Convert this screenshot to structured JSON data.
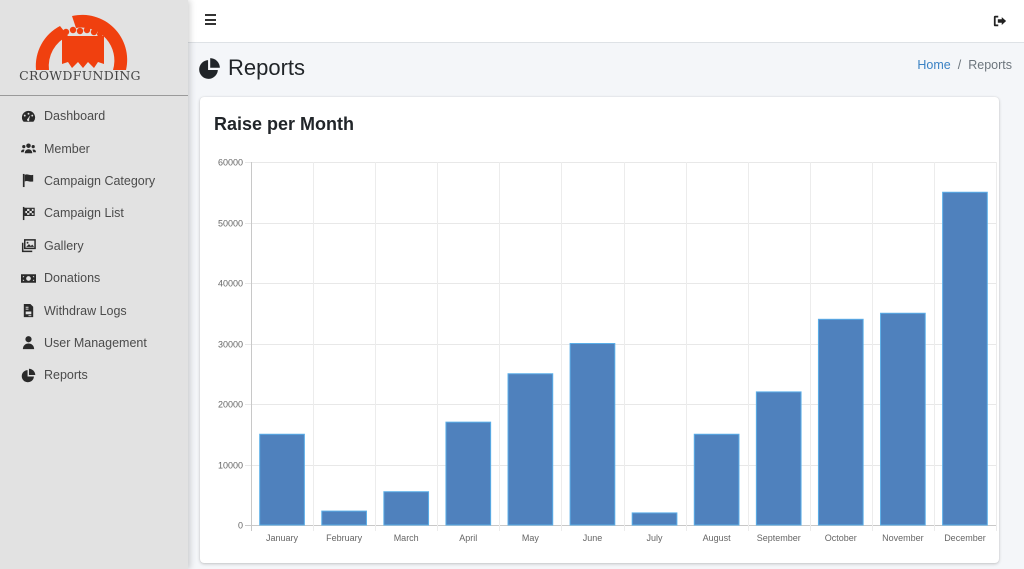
{
  "brand": {
    "name": "CROWDFUNDING",
    "logo_icon": "crowd-arch-logo",
    "logo_color": "#f0400f"
  },
  "sidebar": {
    "items": [
      {
        "label": "Dashboard",
        "icon": "tachometer-icon"
      },
      {
        "label": "Member",
        "icon": "users-icon"
      },
      {
        "label": "Campaign Category",
        "icon": "flag-icon"
      },
      {
        "label": "Campaign List",
        "icon": "checkered-flag-icon"
      },
      {
        "label": "Gallery",
        "icon": "images-icon"
      },
      {
        "label": "Donations",
        "icon": "money-bill-icon"
      },
      {
        "label": "Withdraw Logs",
        "icon": "file-invoice-icon"
      },
      {
        "label": "User Management",
        "icon": "user-icon"
      },
      {
        "label": "Reports",
        "icon": "chart-pie-icon"
      }
    ]
  },
  "topbar": {
    "menu_icon": "hamburger-icon",
    "logout_icon": "sign-out-icon"
  },
  "header": {
    "title": "Reports",
    "title_icon": "chart-pie-icon",
    "breadcrumb": {
      "home": "Home",
      "separator": "/",
      "current": "Reports"
    }
  },
  "card": {
    "title": "Raise per Month"
  },
  "colors": {
    "bar_fill": "#4f81bd",
    "bar_border": "#5aaee8",
    "link": "#3b82c4"
  },
  "chart_data": {
    "type": "bar",
    "title": "Raise per Month",
    "xlabel": "",
    "ylabel": "",
    "categories": [
      "January",
      "February",
      "March",
      "April",
      "May",
      "June",
      "July",
      "August",
      "September",
      "October",
      "November",
      "December"
    ],
    "values": [
      15000,
      2300,
      5500,
      17000,
      25000,
      30000,
      2000,
      15000,
      22000,
      34000,
      35000,
      55000
    ],
    "ylim": [
      0,
      60000
    ],
    "yticks": [
      0,
      10000,
      20000,
      30000,
      40000,
      50000,
      60000
    ],
    "grid": true,
    "legend": "none"
  }
}
